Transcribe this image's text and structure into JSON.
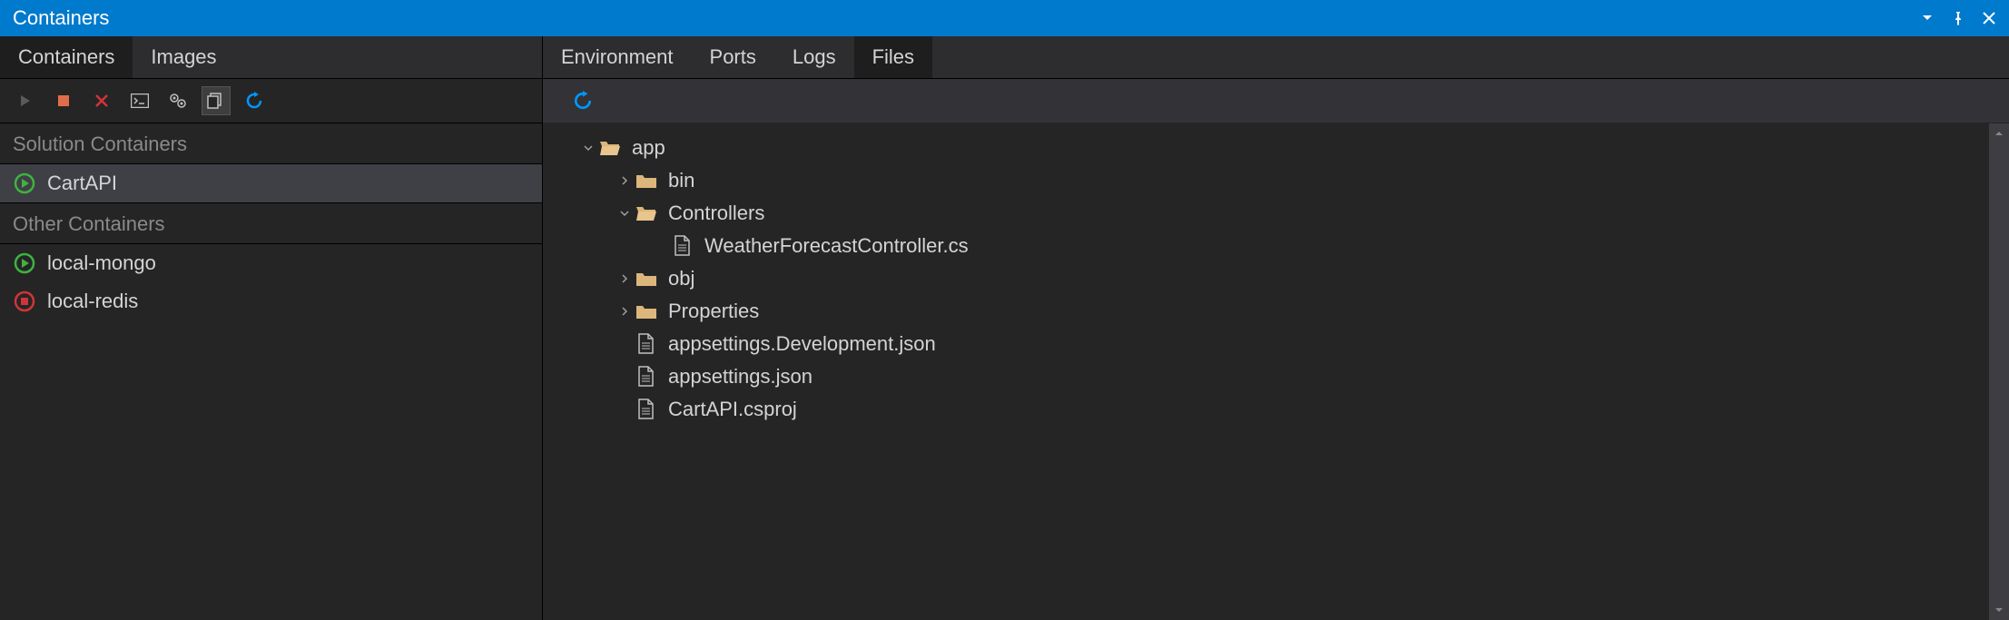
{
  "titlebar": {
    "title": "Containers"
  },
  "left_tabs": {
    "containers": "Containers",
    "images": "Images"
  },
  "left_groups": {
    "solution": "Solution Containers",
    "other": "Other Containers"
  },
  "containers": {
    "solution": [
      {
        "name": "CartAPI",
        "status": "running"
      }
    ],
    "other": [
      {
        "name": "local-mongo",
        "status": "running"
      },
      {
        "name": "local-redis",
        "status": "stopped"
      }
    ]
  },
  "right_tabs": {
    "environment": "Environment",
    "ports": "Ports",
    "logs": "Logs",
    "files": "Files"
  },
  "file_tree": {
    "app": "app",
    "bin": "bin",
    "controllers": "Controllers",
    "weather": "WeatherForecastController.cs",
    "obj": "obj",
    "properties": "Properties",
    "appsettings_dev": "appsettings.Development.json",
    "appsettings": "appsettings.json",
    "csproj": "CartAPI.csproj"
  }
}
